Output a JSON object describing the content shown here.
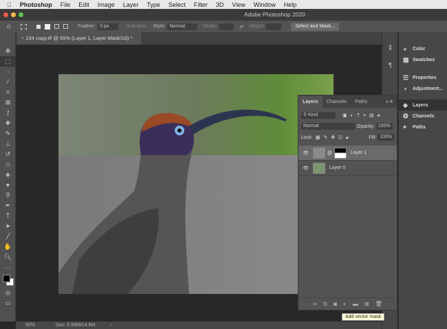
{
  "menubar": {
    "items": [
      "Photoshop",
      "File",
      "Edit",
      "Image",
      "Layer",
      "Type",
      "Select",
      "Filter",
      "3D",
      "View",
      "Window",
      "Help"
    ]
  },
  "window": {
    "title": "Adobe Photoshop 2020"
  },
  "options": {
    "feather_label": "Feather:",
    "feather_value": "0 px",
    "antialias": "Anti-alias",
    "style_label": "Style:",
    "style_value": "Normal",
    "width_label": "Width:",
    "height_label": "Height:",
    "select_mask": "Select and Mask..."
  },
  "document": {
    "tab": "234 copy.tif @ 55% (Layer 1, Layer Mask/16) *"
  },
  "status": {
    "zoom": "55%",
    "doc": "Doc: 6.59M/14.8M"
  },
  "right_panel": {
    "items": [
      "Color",
      "Swatches",
      "Properties",
      "Adjustment...",
      "Layers",
      "Channels",
      "Paths"
    ]
  },
  "layers_panel": {
    "tabs": [
      "Layers",
      "Channels",
      "Paths"
    ],
    "filter": "Kind",
    "blend_mode": "Normal",
    "opacity_label": "Opacity:",
    "opacity": "100%",
    "lock_label": "Lock:",
    "fill_label": "Fill:",
    "fill": "100%",
    "layers": [
      {
        "name": "Layer 1"
      },
      {
        "name": "Layer 0"
      }
    ]
  },
  "tooltip": "Add vector mask"
}
